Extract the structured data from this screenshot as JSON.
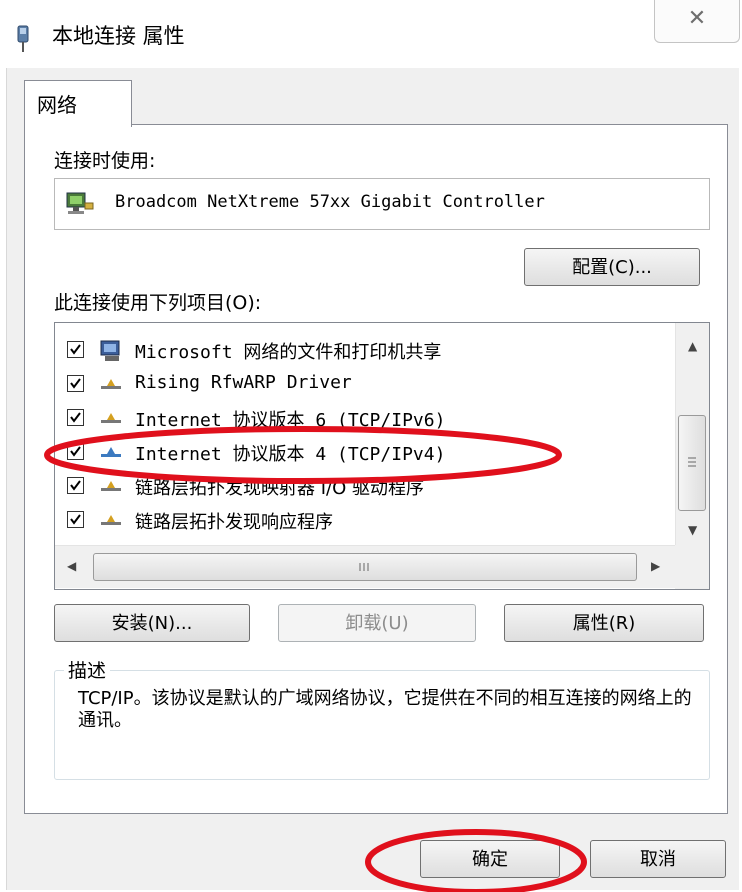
{
  "window": {
    "title": "本地连接 属性",
    "close_glyph": "✕"
  },
  "tabs": [
    {
      "label": "网络",
      "selected": true
    }
  ],
  "connect_using": {
    "label": "连接时使用:",
    "adapter": "Broadcom NetXtreme 57xx Gigabit Controller",
    "configure_button": "配置(C)..."
  },
  "items": {
    "label": "此连接使用下列项目(O):",
    "list": [
      {
        "label": "Microsoft 网络的文件和打印机共享",
        "checked": true,
        "icon": "printer-share-icon"
      },
      {
        "label": "Rising RfwARP Driver",
        "checked": true,
        "icon": "protocol-icon"
      },
      {
        "label": "Internet 协议版本 6 (TCP/IPv6)",
        "checked": true,
        "icon": "protocol-icon"
      },
      {
        "label": "Internet 协议版本 4 (TCP/IPv4)",
        "checked": true,
        "icon": "protocol-icon",
        "highlighted": true
      },
      {
        "label": "链路层拓扑发现映射器 I/O 驱动程序",
        "checked": true,
        "icon": "protocol-icon"
      },
      {
        "label": "链路层拓扑发现响应程序",
        "checked": true,
        "icon": "protocol-icon"
      }
    ]
  },
  "buttons": {
    "install": "安装(N)...",
    "uninstall": "卸载(U)",
    "properties": "属性(R)",
    "ok": "确定",
    "cancel": "取消"
  },
  "description": {
    "legend": "描述",
    "text": "TCP/IP。该协议是默认的广域网络协议，它提供在不同的相互连接的网络上的通讯。"
  },
  "colors": {
    "annotation_red": "#e0101c",
    "window_bg": "#f0f0f0"
  }
}
